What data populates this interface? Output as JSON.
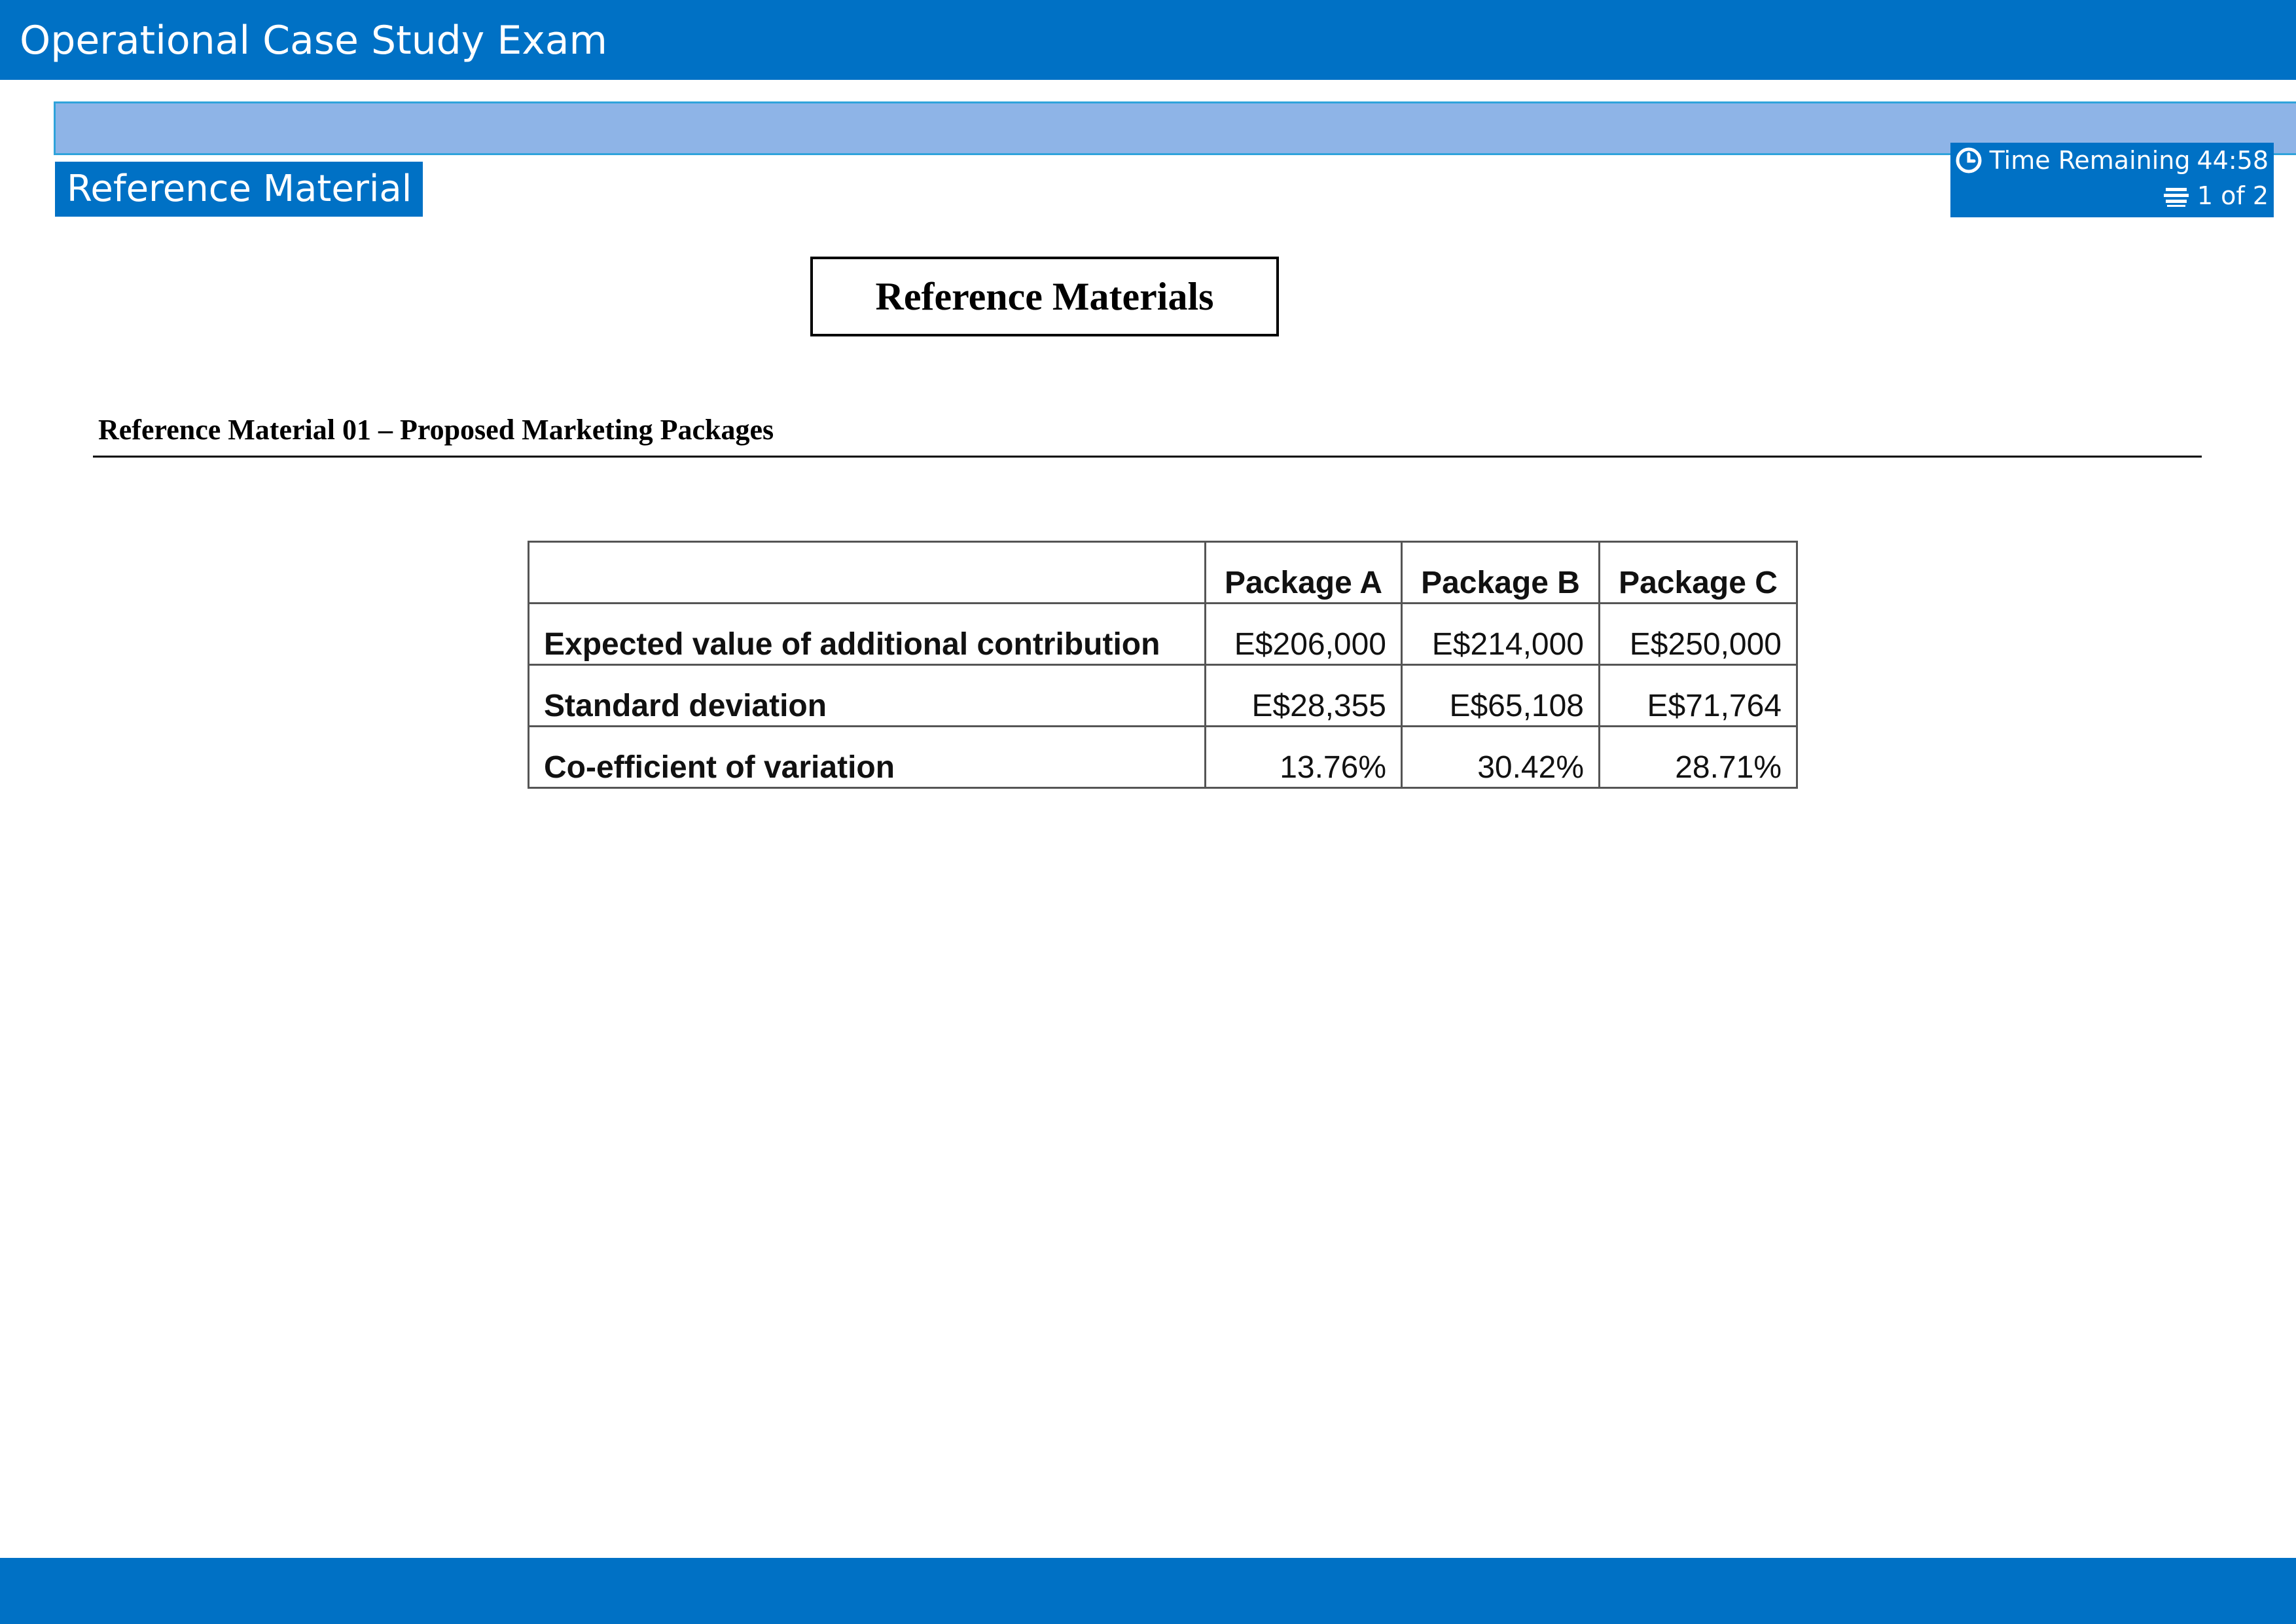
{
  "app": {
    "title": "Operational Case Study Exam"
  },
  "section_tab": {
    "label": "Reference Material"
  },
  "status": {
    "time_label": "Time Remaining",
    "time_value": "44:58",
    "page_indicator": "1 of 2",
    "icons": [
      "clock-icon",
      "pages-icon"
    ]
  },
  "document": {
    "main_title": "Reference Materials",
    "section_heading": "Reference Material 01 – Proposed Marketing Packages",
    "table": {
      "headers": [
        "",
        "Package A",
        "Package B",
        "Package C"
      ],
      "rows": [
        {
          "label": "Expected value of additional contribution",
          "values": [
            "E$206,000",
            "E$214,000",
            "E$250,000"
          ]
        },
        {
          "label": "Standard deviation",
          "values": [
            "E$28,355",
            "E$65,108",
            "E$71,764"
          ]
        },
        {
          "label": "Co-efficient of variation",
          "values": [
            "13.76%",
            "30.42%",
            "28.71%"
          ]
        }
      ]
    }
  },
  "colors": {
    "header_blue": "#0071C5",
    "sub_bar_blue": "#8EB4E7",
    "sub_bar_border": "#2FA3DB"
  }
}
